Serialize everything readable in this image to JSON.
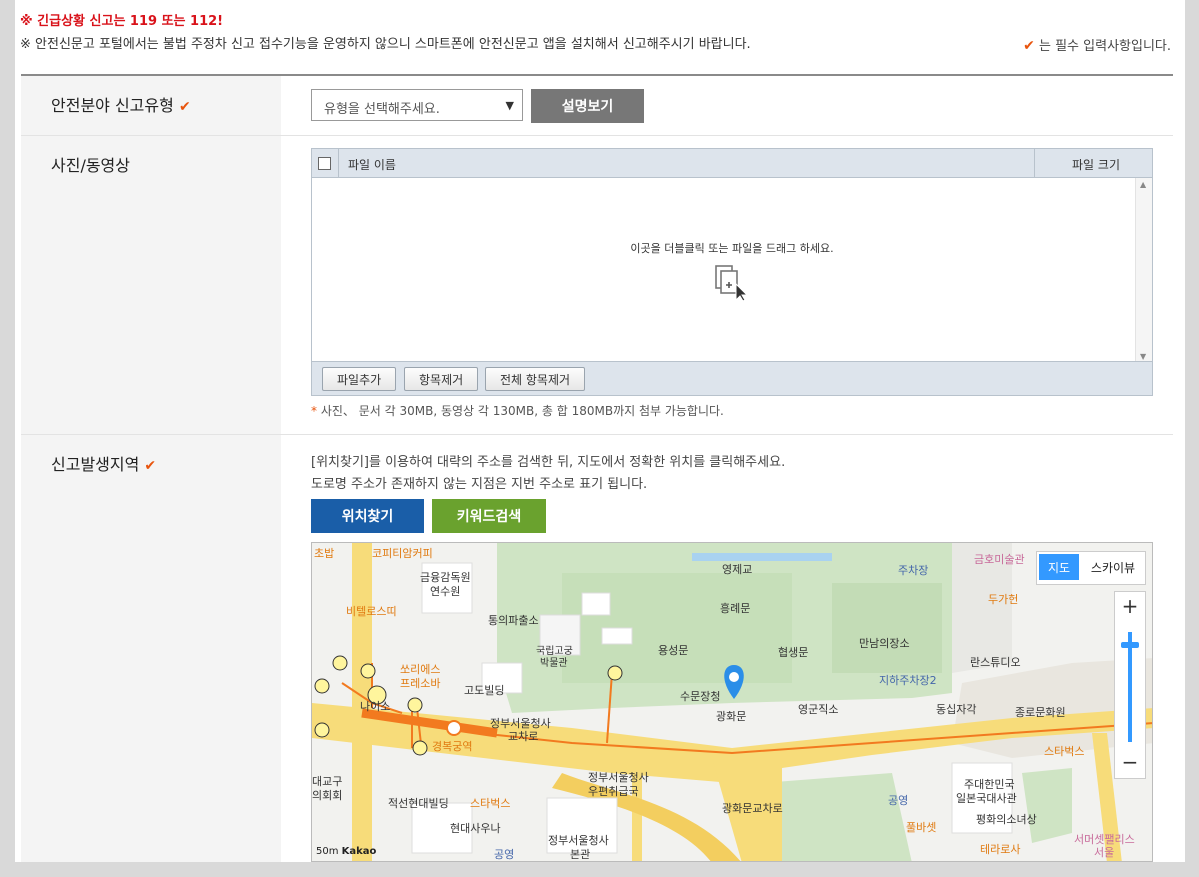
{
  "notices": {
    "emergency": "※ 긴급상황 신고는 119 또는 112!",
    "portal": "※ 안전신문고 포털에서는 불법 주정차 신고 접수기능을 운영하지 않으니 스마트폰에 안전신문고 앱을 설치해서 신고해주시기 바랍니다.",
    "required": "는 필수 입력사항입니다."
  },
  "icons": {
    "required_check": "✔"
  },
  "colors": {
    "accent": "#e8540d",
    "blue_button": "#1a5ea8",
    "green_button": "#6aa22e",
    "gray_button": "#777777"
  },
  "form": {
    "type": {
      "label": "안전분야 신고유형",
      "select_value": "유형을 선택해주세요.",
      "explain_button": "설명보기"
    },
    "media": {
      "label": "사진/동영상",
      "col_name": "파일 이름",
      "col_size": "파일 크기",
      "drop_hint": "이곳을 더블클릭 또는 파일을 드래그 하세요.",
      "buttons": [
        "파일추가",
        "항목제거",
        "전체 항목제거"
      ],
      "limit_note": "사진、 문서 각 30MB, 동영상 각 130MB, 총 합 180MB까지 첨부 가능합니다.",
      "limit_star": "*"
    },
    "location": {
      "label": "신고발생지역",
      "desc1": "[위치찾기]를 이용하여 대략의 주소를 검색한 뒤, 지도에서 정확한 위치를 클릭해주세요.",
      "desc2": "도로명 주소가 존재하지 않는 지점은 지번 주소로 표기 됩니다.",
      "find_button": "위치찾기",
      "keyword_button": "키워드검색"
    }
  },
  "map": {
    "type_map": "지도",
    "type_sky": "스카이뷰",
    "zoom_in": "+",
    "zoom_out": "−",
    "scale": "50m",
    "provider": "Kakao",
    "labels": {
      "l1": "초밥",
      "l2": "코피티암커피",
      "l3": "금융감독원",
      "l4": "연수원",
      "l5": "비텔로스띠",
      "l6": "통의파출소",
      "l7": "국립고궁",
      "l8": "박물관",
      "l9": "쏘리에스",
      "l10": "프레소바",
      "l11": "고도빌딩",
      "l12": "영제교",
      "l13": "흥례문",
      "l14": "용성문",
      "l15": "협생문",
      "l16": "수문장청",
      "l17": "광화문",
      "l18": "영군직소",
      "l19": "만남의장소",
      "l20": "지하주차장2",
      "l21": "주차장",
      "l22": "금호미술관",
      "l23": "두가헌",
      "l24": "란스튜디오",
      "l25": "동십자각",
      "l26": "종로문화원",
      "l27": "스타벅스",
      "l28": "주대한민국",
      "l29": "일본국대사관",
      "l30": "평화의소녀상",
      "l31": "서머셋팰리스",
      "l32": "서울",
      "l33": "정부서울청사",
      "l34": "교차로",
      "l35": "경복궁역",
      "l36": "정부서울청사",
      "l37": "우편취급국",
      "l38": "적선현대빌딩",
      "l39": "스타벅스",
      "l40": "현대사우나",
      "l41": "정부서울청사",
      "l42": "본관",
      "l43": "광화문교차로",
      "l44": "공영",
      "l45": "풀바셋",
      "l46": "테라로사",
      "l47": "공영",
      "l48": "대교구",
      "l49": "의회회",
      "l50": "나이소"
    }
  }
}
